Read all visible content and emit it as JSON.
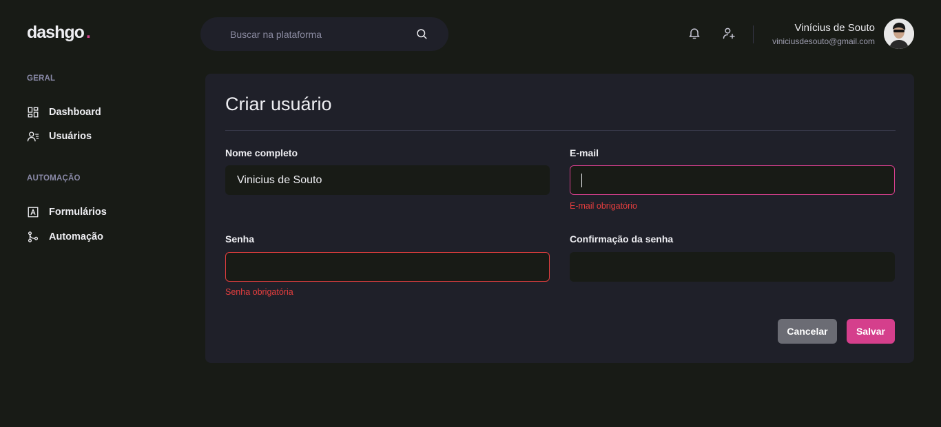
{
  "logo": {
    "text": "dashgo",
    "dot": "."
  },
  "search": {
    "placeholder": "Buscar na plataforma"
  },
  "user": {
    "name": "Vinícius de Souto",
    "email": "viniciusdesouto@gmail.com"
  },
  "sidebar": {
    "sections": [
      {
        "title": "GERAL",
        "items": [
          {
            "label": "Dashboard",
            "icon": "dashboard-icon"
          },
          {
            "label": "Usuários",
            "icon": "users-icon"
          }
        ]
      },
      {
        "title": "AUTOMAÇÃO",
        "items": [
          {
            "label": "Formulários",
            "icon": "form-icon"
          },
          {
            "label": "Automação",
            "icon": "git-merge-icon"
          }
        ]
      }
    ]
  },
  "form": {
    "title": "Criar usuário",
    "name": {
      "label": "Nome completo",
      "value": "Vinicius de Souto"
    },
    "email": {
      "label": "E-mail",
      "value": "",
      "error": "E-mail obrigatório"
    },
    "password": {
      "label": "Senha",
      "value": "",
      "error": "Senha obrigatória"
    },
    "password_confirmation": {
      "label": "Confirmação da senha",
      "value": ""
    },
    "cancel_label": "Cancelar",
    "save_label": "Salvar"
  },
  "colors": {
    "background": "#181b16",
    "card": "#1f2029",
    "accent": "#d53f8c",
    "error": "#e53e3e"
  }
}
